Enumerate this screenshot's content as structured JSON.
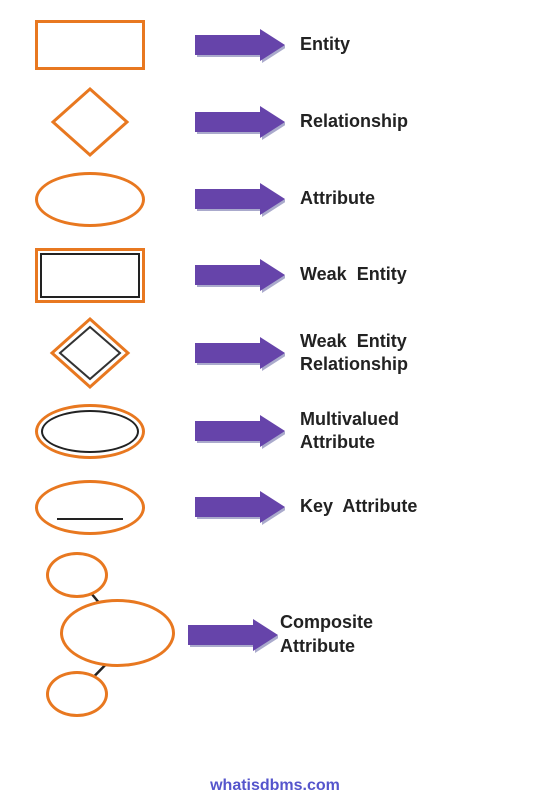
{
  "rows": [
    {
      "id": "entity",
      "label": "Entity"
    },
    {
      "id": "relationship",
      "label": "Relationship"
    },
    {
      "id": "attribute",
      "label": "Attribute"
    },
    {
      "id": "weak-entity",
      "label": "Weak  Entity"
    },
    {
      "id": "weak-entity-rel",
      "label": "Weak  Entity\nRelationship"
    },
    {
      "id": "multivalued",
      "label": "Multivalued\nAttribute"
    },
    {
      "id": "key-attribute",
      "label": "Key  Attribute"
    }
  ],
  "composite": {
    "label_line1": "Composite",
    "label_line2": "Attribute"
  },
  "watermark": "whatisdbms.com",
  "arrow_color": "#6644aa",
  "arrow_shadow_color": "#aaaacc"
}
